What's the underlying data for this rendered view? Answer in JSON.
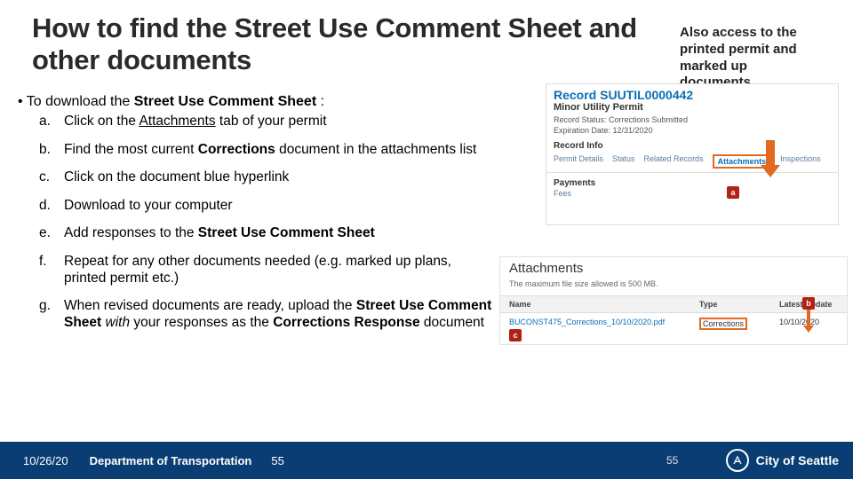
{
  "title": "How to find the Street Use Comment Sheet and other documents",
  "aside": {
    "line1": "Also access to the",
    "line2": "printed permit and",
    "line3": "marked up",
    "line4": "documents"
  },
  "bullet_prefix": "To download the ",
  "bullet_bold": "Street Use Comment Sheet",
  "bullet_suffix": " :",
  "steps": {
    "a": {
      "letter": "a.",
      "p1": "Click on the ",
      "u1": "Attachments",
      "p2": " tab of your permit"
    },
    "b": {
      "letter": "b.",
      "p1": "Find the most current ",
      "b1": "Corrections",
      "p2": " document in the attachments list"
    },
    "c": {
      "letter": "c.",
      "text": "Click on the document blue hyperlink"
    },
    "d": {
      "letter": "d.",
      "text": "Download to your computer"
    },
    "e": {
      "letter": "e.",
      "p1": "Add responses to the ",
      "b1": "Street Use Comment Sheet"
    },
    "f": {
      "letter": "f.",
      "text": "Repeat for any other documents needed (e.g. marked up plans, printed permit etc.)"
    },
    "g": {
      "letter": "g.",
      "p1": "When revised documents are ready, upload the ",
      "b1": "Street Use Comment Sheet ",
      "p2": " ",
      "i1": "with",
      "p3": " your responses as the ",
      "b2": "Corrections Response",
      "p4": "  document"
    }
  },
  "record": {
    "title": "Record SUUTIL0000442",
    "subtitle": "Minor Utility Permit",
    "status": "Record Status: Corrections Submitted",
    "expiry": "Expiration Date: 12/31/2020",
    "info_label": "Record Info",
    "tabs": {
      "details": "Permit Details",
      "status": "Status",
      "related": "Related Records",
      "attach": "Attachments",
      "insp": "Inspections"
    },
    "payments": "Payments",
    "fees": "Fees"
  },
  "attachments": {
    "title": "Attachments",
    "note": "The maximum file size allowed is 500 MB.",
    "headers": {
      "name": "Name",
      "type": "Type",
      "updated": "Latest Update"
    },
    "row": {
      "name": "BUCONST475_Corrections_10/10/2020.pdf",
      "type": "Corrections",
      "updated": "10/10/2020"
    }
  },
  "markers": {
    "a": "a",
    "b": "b",
    "c": "c"
  },
  "footer": {
    "date": "10/26/20",
    "dept": "Department of Transportation",
    "pg1": "55",
    "pg2": "55",
    "city": "City of Seattle"
  }
}
